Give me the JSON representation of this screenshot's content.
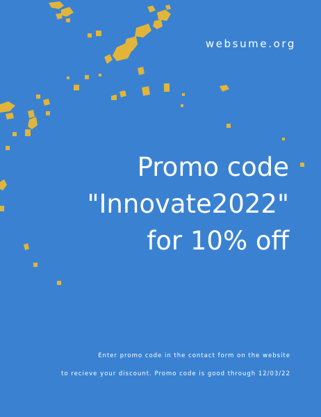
{
  "page": {
    "background_color": "#3a82d1",
    "glitter_color": "#e2b53a",
    "site": "websume.org",
    "headline": [
      "Promo code",
      "\"Innovate2022\"",
      "for 10% off"
    ],
    "fine_print": [
      "Enter promo code in the contact form on the website",
      "to recieve your discount. Promo code is good through 12/03/22"
    ]
  }
}
